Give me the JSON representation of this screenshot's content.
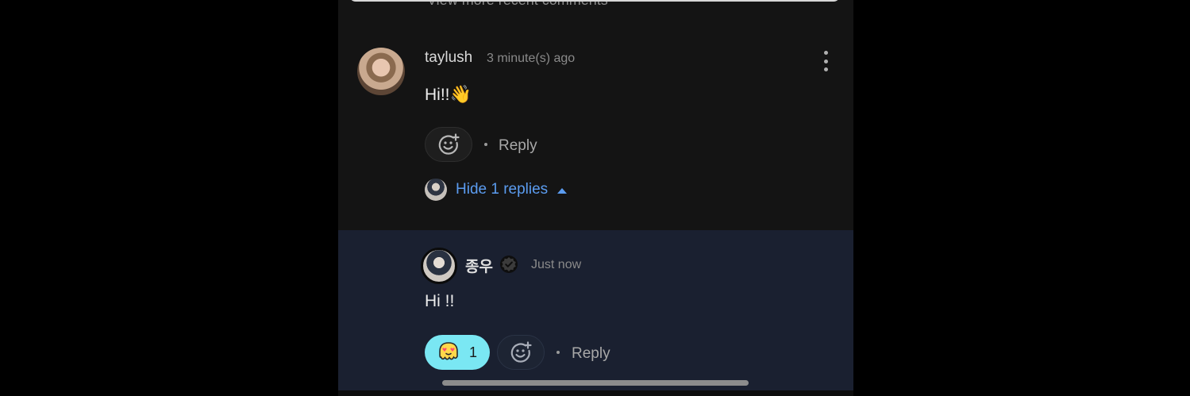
{
  "top": {
    "view_more_label": "View more recent comments"
  },
  "comment": {
    "username": "taylush",
    "timestamp": "3 minute(s) ago",
    "text": "Hi!!",
    "emoji": "👋",
    "reply_label": "Reply",
    "hide_replies_label": "Hide 1 replies"
  },
  "reply": {
    "username": "종우",
    "timestamp": "Just now",
    "text": "Hi !!",
    "reaction_count": "1",
    "reply_label": "Reply"
  },
  "colors": {
    "accent_blue": "#5b9cf0",
    "reaction_pill": "#7ae7f3",
    "reply_bg": "#1a2030"
  },
  "icons": [
    "more-vertical-icon",
    "add-reaction-icon",
    "caret-up-icon",
    "verified-badge-icon",
    "heart-eyes-ghost-icon"
  ]
}
